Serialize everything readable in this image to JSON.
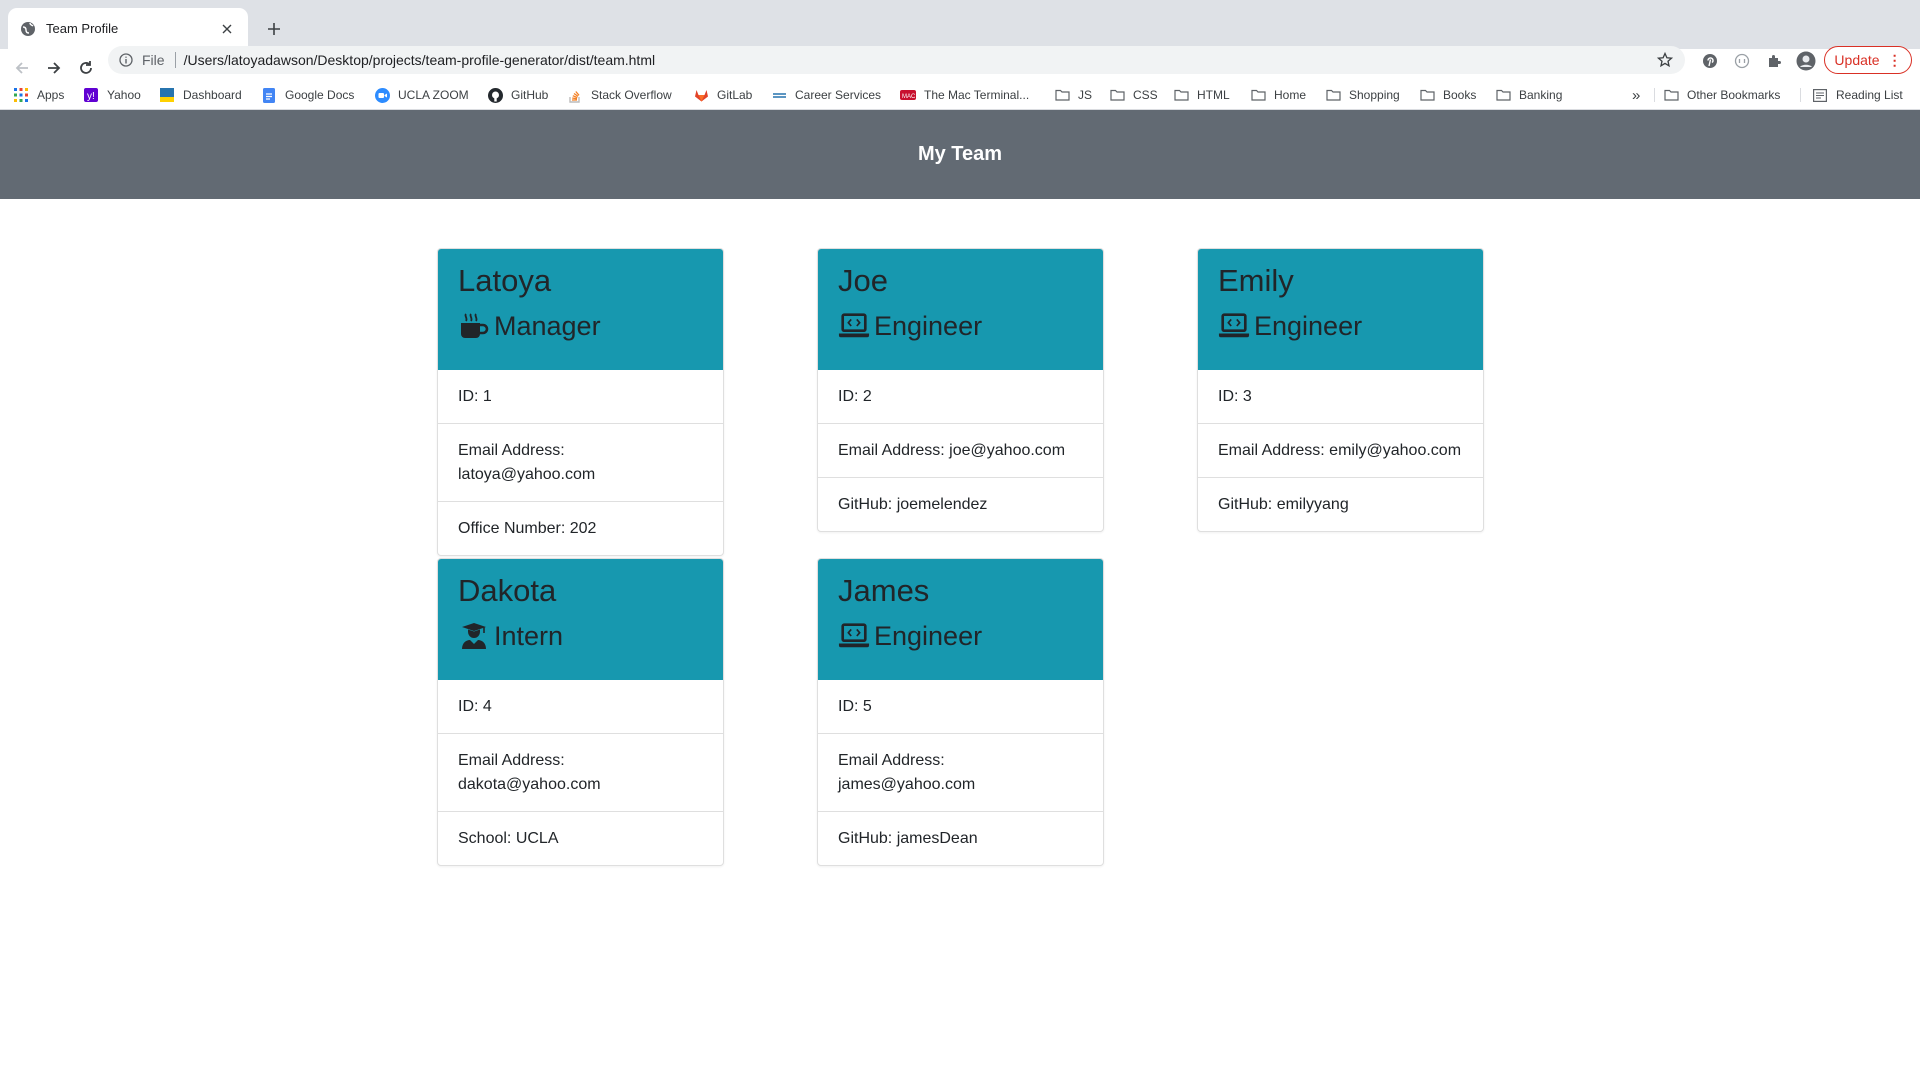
{
  "browser": {
    "tab_title": "Team Profile",
    "url_scheme": "File",
    "url": "/Users/latoyadawson/Desktop/projects/team-profile-generator/dist/team.html",
    "update_label": "Update",
    "bookmarks": [
      {
        "label": "Apps",
        "icon": "apps-grid-icon"
      },
      {
        "label": "Yahoo",
        "icon": "yahoo-icon"
      },
      {
        "label": "Dashboard",
        "icon": "ucla-icon"
      },
      {
        "label": "Google Docs",
        "icon": "google-docs-icon"
      },
      {
        "label": "UCLA ZOOM",
        "icon": "zoom-icon"
      },
      {
        "label": "GitHub",
        "icon": "github-icon"
      },
      {
        "label": "Stack Overflow",
        "icon": "stack-overflow-icon"
      },
      {
        "label": "GitLab",
        "icon": "gitlab-icon"
      },
      {
        "label": "Career Services",
        "icon": "career-services-icon"
      },
      {
        "label": "The Mac Terminal...",
        "icon": "mac-terminal-icon"
      },
      {
        "label": "JS",
        "icon": "folder-icon"
      },
      {
        "label": "CSS",
        "icon": "folder-icon"
      },
      {
        "label": "HTML",
        "icon": "folder-icon"
      },
      {
        "label": "Home",
        "icon": "folder-icon"
      },
      {
        "label": "Shopping",
        "icon": "folder-icon"
      },
      {
        "label": "Books",
        "icon": "folder-icon"
      },
      {
        "label": "Banking",
        "icon": "folder-icon"
      }
    ],
    "overflow_label": "»",
    "other_bookmarks": "Other Bookmarks",
    "reading_list": "Reading List"
  },
  "page": {
    "title": "My Team",
    "colors": {
      "header_bg": "#626a73",
      "card_header_bg": "#1798af"
    },
    "cards": [
      {
        "name": "Latoya",
        "role": "Manager",
        "role_icon": "coffee-mug-icon",
        "id": "ID: 1",
        "email_label": "Email Address:",
        "email": "latoya@yahoo.com",
        "extra": "Office Number: 202"
      },
      {
        "name": "Joe",
        "role": "Engineer",
        "role_icon": "laptop-code-icon",
        "id": "ID: 2",
        "email_label": "Email Address:",
        "email": "joe@yahoo.com",
        "extra": "GitHub: joemelendez"
      },
      {
        "name": "Emily",
        "role": "Engineer",
        "role_icon": "laptop-code-icon",
        "id": "ID: 3",
        "email_label": "Email Address:",
        "email": "emily@yahoo.com",
        "extra": "GitHub: emilyyang"
      },
      {
        "name": "Dakota",
        "role": "Intern",
        "role_icon": "graduate-icon",
        "id": "ID: 4",
        "email_label": "Email Address:",
        "email": "dakota@yahoo.com",
        "extra": "School: UCLA"
      },
      {
        "name": "James",
        "role": "Engineer",
        "role_icon": "laptop-code-icon",
        "id": "ID: 5",
        "email_label": "Email Address:",
        "email": "james@yahoo.com",
        "extra": "GitHub: jamesDean"
      }
    ]
  }
}
